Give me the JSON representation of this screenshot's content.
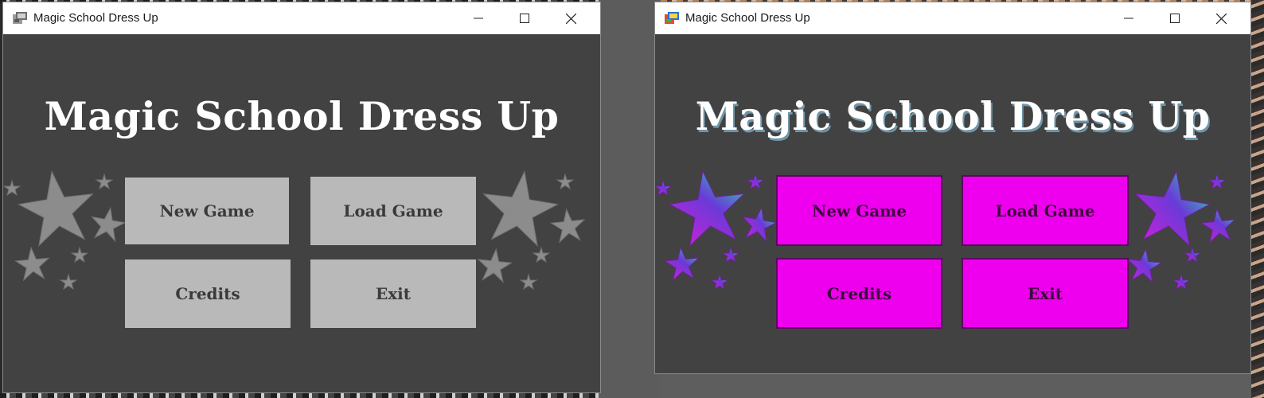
{
  "windows": [
    {
      "title": "Magic School Dress Up",
      "game_title": "Magic School Dress Up",
      "buttons": {
        "new_game": "New Game",
        "load_game": "Load Game",
        "credits": "Credits",
        "exit": "Exit"
      },
      "theme": {
        "button_color": "#b9b9b9",
        "star_color": "#8c8c8c"
      }
    },
    {
      "title": "Magic School Dress Up",
      "game_title": "Magic School Dress Up",
      "buttons": {
        "new_game": "New Game",
        "load_game": "Load Game",
        "credits": "Credits",
        "exit": "Exit"
      },
      "theme": {
        "button_color": "#ee00ee",
        "star_color": "#9b2bd6"
      }
    }
  ],
  "icons": [
    "app-icon",
    "minimize-icon",
    "maximize-icon",
    "close-icon",
    "star-icon"
  ]
}
